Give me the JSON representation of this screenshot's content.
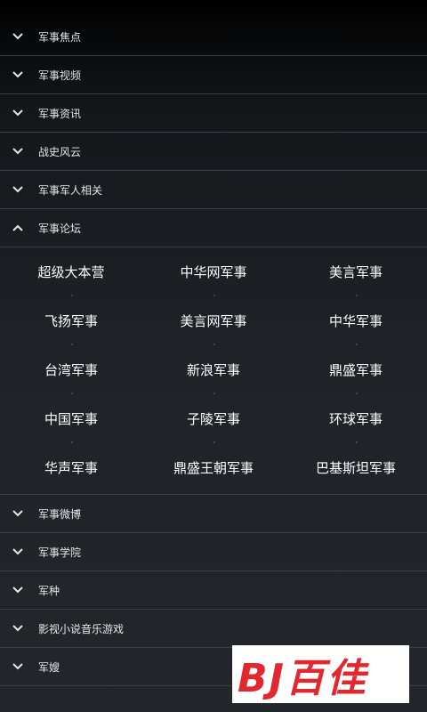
{
  "sections_top": [
    {
      "label": "军事焦点",
      "expanded": false
    },
    {
      "label": "军事视频",
      "expanded": false
    },
    {
      "label": "军事资讯",
      "expanded": false
    },
    {
      "label": "战史风云",
      "expanded": false
    },
    {
      "label": "军事军人相关",
      "expanded": false
    },
    {
      "label": "军事论坛",
      "expanded": true
    }
  ],
  "forum_links": [
    [
      "超级大本营",
      "中华网军事",
      "美言军事"
    ],
    [
      "飞扬军事",
      "美言网军事",
      "中华军事"
    ],
    [
      "台湾军事",
      "新浪军事",
      "鼎盛军事"
    ],
    [
      "中国军事",
      "子陵军事",
      "环球军事"
    ],
    [
      "华声军事",
      "鼎盛王朝军事",
      "巴基斯坦军事"
    ]
  ],
  "sections_bottom": [
    {
      "label": "军事微博",
      "expanded": false
    },
    {
      "label": "军事学院",
      "expanded": false
    },
    {
      "label": "军种",
      "expanded": false
    },
    {
      "label": "影视小说音乐游戏",
      "expanded": false
    },
    {
      "label": "军嫂",
      "expanded": false
    }
  ],
  "watermark": {
    "text": "BJ百佳"
  }
}
